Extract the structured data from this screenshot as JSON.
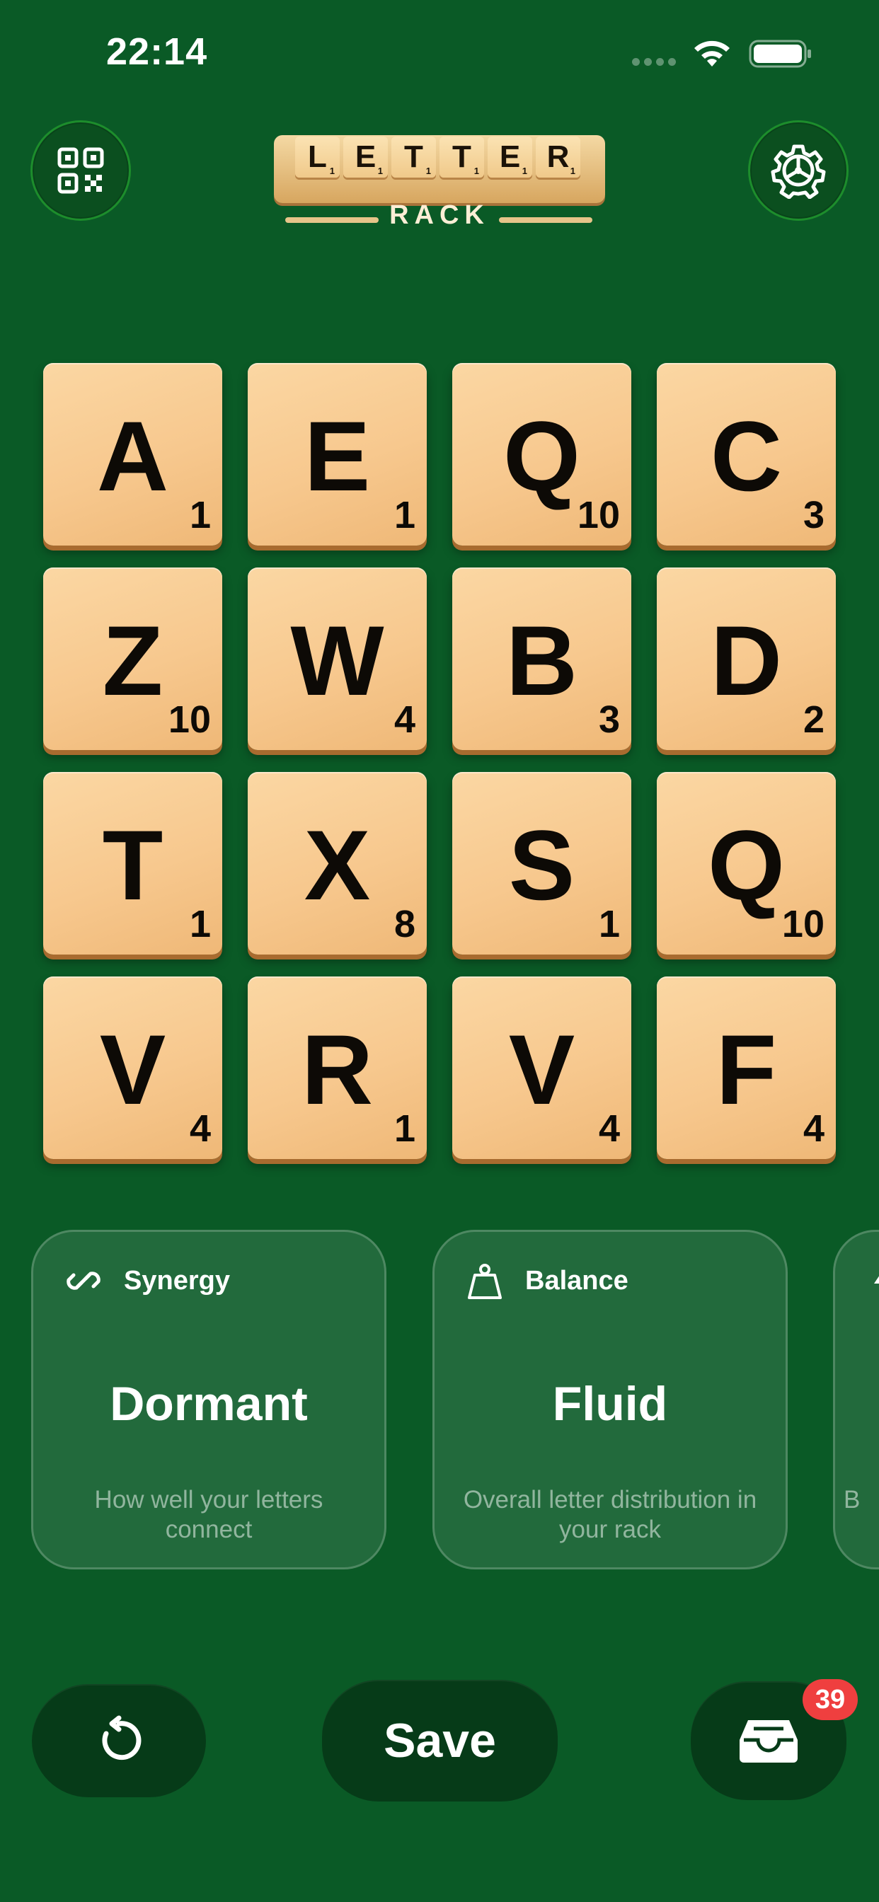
{
  "status_bar": {
    "time": "22:14",
    "icons": [
      "cellular-dots-icon",
      "wifi-icon",
      "battery-icon"
    ]
  },
  "header": {
    "left_button_icon": "qr-code-icon",
    "right_button_icon": "gear-icon",
    "logo": {
      "tiles": [
        {
          "letter": "L",
          "points": "1"
        },
        {
          "letter": "E",
          "points": "1"
        },
        {
          "letter": "T",
          "points": "1"
        },
        {
          "letter": "T",
          "points": "1"
        },
        {
          "letter": "E",
          "points": "1"
        },
        {
          "letter": "R",
          "points": "1"
        }
      ],
      "word": "RACK"
    }
  },
  "rack": {
    "tiles": [
      {
        "letter": "A",
        "points": "1"
      },
      {
        "letter": "E",
        "points": "1"
      },
      {
        "letter": "Q",
        "points": "10"
      },
      {
        "letter": "C",
        "points": "3"
      },
      {
        "letter": "Z",
        "points": "10"
      },
      {
        "letter": "W",
        "points": "4"
      },
      {
        "letter": "B",
        "points": "3"
      },
      {
        "letter": "D",
        "points": "2"
      },
      {
        "letter": "T",
        "points": "1"
      },
      {
        "letter": "X",
        "points": "8"
      },
      {
        "letter": "S",
        "points": "1"
      },
      {
        "letter": "Q",
        "points": "10"
      },
      {
        "letter": "V",
        "points": "4"
      },
      {
        "letter": "R",
        "points": "1"
      },
      {
        "letter": "V",
        "points": "4"
      },
      {
        "letter": "F",
        "points": "4"
      }
    ]
  },
  "cards": [
    {
      "icon": "link-icon",
      "title": "Synergy",
      "value": "Dormant",
      "description": "How well your letters connect"
    },
    {
      "icon": "weight-icon",
      "title": "Balance",
      "value": "Fluid",
      "description": "Overall letter distribution in your rack"
    },
    {
      "icon": "bolt-icon",
      "title": "",
      "value": "",
      "description": "B"
    }
  ],
  "bottom_bar": {
    "undo_icon": "undo-icon",
    "save_label": "Save",
    "inbox_icon": "inbox-tray-icon",
    "inbox_badge": "39"
  },
  "colors": {
    "background": "#0a5a26",
    "tile": "#f7c88e",
    "button_dark": "#063b18",
    "badge": "#ef3f3f"
  }
}
